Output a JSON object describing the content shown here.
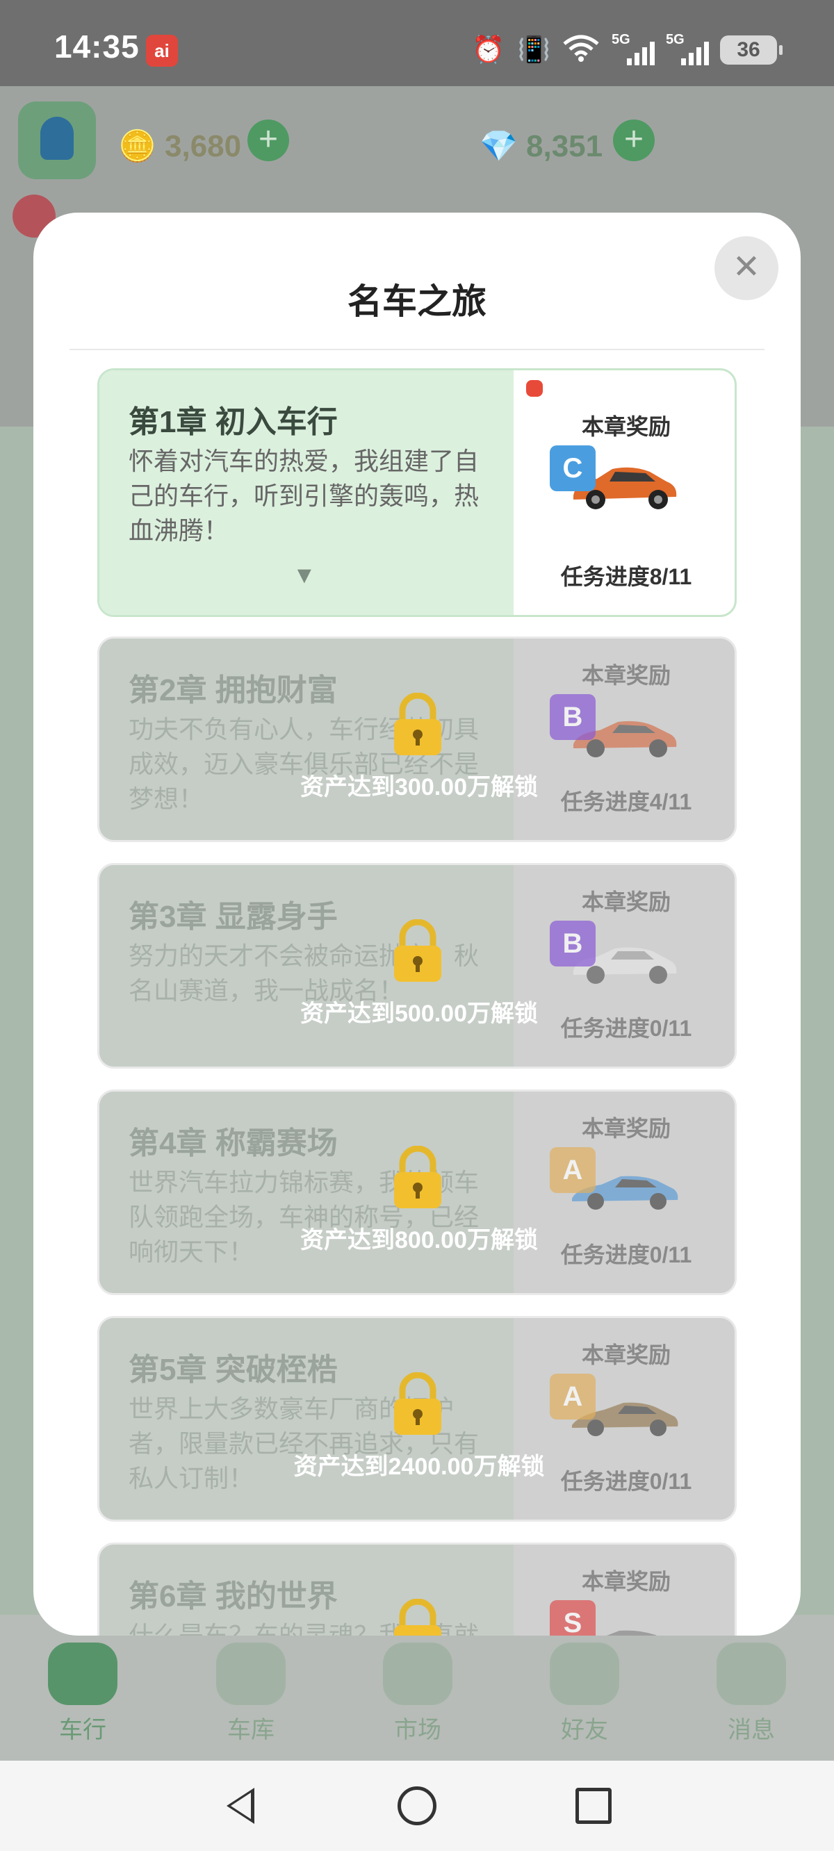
{
  "status_bar": {
    "time": "14:35",
    "app_badge": "ai",
    "network_1": "5G",
    "network_2": "5G",
    "battery": "36"
  },
  "background": {
    "coins": "3,680",
    "gems": "8,351",
    "nav": [
      "车行",
      "车库",
      "市场",
      "好友",
      "消息"
    ]
  },
  "modal": {
    "title": "名车之旅",
    "reward_label": "本章奖励",
    "chapters": [
      {
        "title": "第1章 初入车行",
        "desc": "怀着对汽车的热爱，我组建了自己的车行，听到引擎的轰鸣，热血沸腾！",
        "grade": "C",
        "progress": "任务进度8/11",
        "car_color": "#e06a2a",
        "locked": false
      },
      {
        "title": "第2章 拥抱财富",
        "desc": "功夫不负有心人，车行经营初具成效，迈入豪车俱乐部已经不是梦想！",
        "grade": "B",
        "progress": "任务进度4/11",
        "unlock": "资产达到300.00万解锁",
        "car_color": "#d45a2e",
        "locked": true
      },
      {
        "title": "第3章 显露身手",
        "desc": "努力的天才不会被命运抛弃，秋名山赛道，我一战成名！",
        "grade": "B",
        "progress": "任务进度0/11",
        "unlock": "资产达到500.00万解锁",
        "car_color": "#e8e8e8",
        "locked": true
      },
      {
        "title": "第4章 称霸赛场",
        "desc": "世界汽车拉力锦标赛，我的领车队领跑全场，车神的称号，已经响彻天下！",
        "grade": "A",
        "progress": "任务进度0/11",
        "unlock": "资产达到800.00万解锁",
        "car_color": "#3f8fd8",
        "locked": true
      },
      {
        "title": "第5章 突破桎梏",
        "desc": "世界上大多数豪车厂商的拥护者，限量款已经不再追求，只有私人订制！",
        "grade": "A",
        "progress": "任务进度0/11",
        "unlock": "资产达到2400.00万解锁",
        "car_color": "#8a6a3a",
        "locked": true
      },
      {
        "title": "第6章 我的世界",
        "desc": "什么是车？车的灵魂？我一直就",
        "grade": "S",
        "progress": "",
        "unlock": "",
        "car_color": "#777777",
        "locked": true
      }
    ]
  },
  "colors": {
    "grade_C": "#4a9ee0",
    "grade_B": "#8a5bd6",
    "grade_A": "#e0b060",
    "grade_S": "#e05050",
    "accent_green": "#dcf0de"
  }
}
